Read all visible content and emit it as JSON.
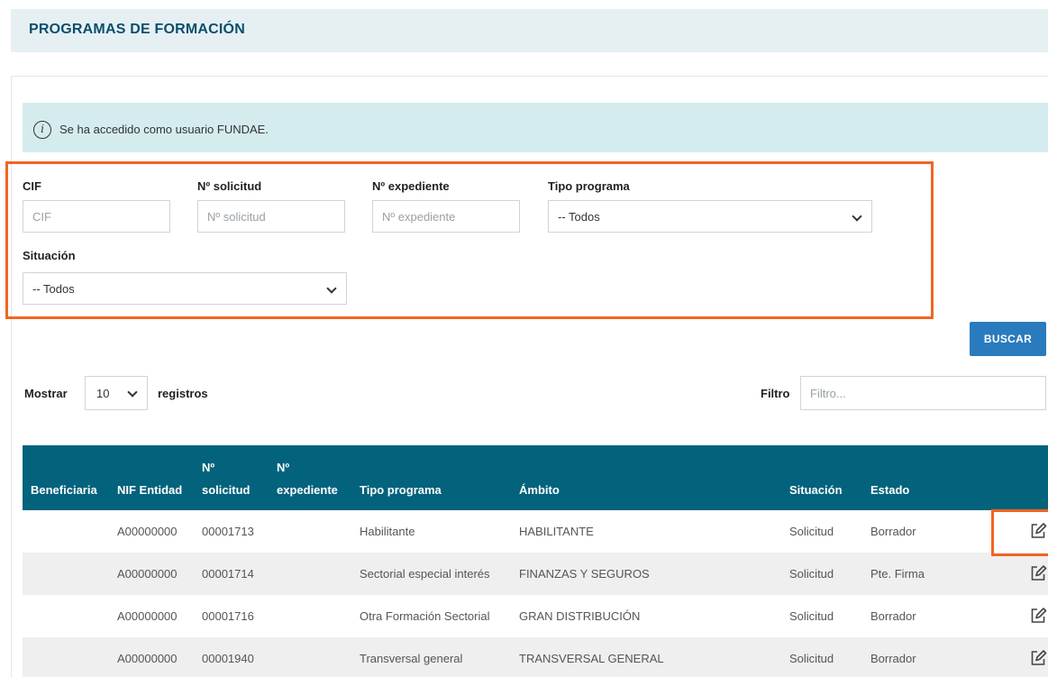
{
  "header": {
    "title": "PROGRAMAS DE FORMACIÓN"
  },
  "info": {
    "message": "Se ha accedido como usuario FUNDAE.",
    "icon": "info-icon"
  },
  "filters": {
    "cif": {
      "label": "CIF",
      "placeholder": "CIF"
    },
    "n_solicitud": {
      "label": "Nº solicitud",
      "placeholder": "Nº solicitud"
    },
    "n_expediente": {
      "label": "Nº expediente",
      "placeholder": "Nº expediente"
    },
    "tipo_programa": {
      "label": "Tipo programa",
      "value": "-- Todos"
    },
    "situacion": {
      "label": "Situación",
      "value": "-- Todos"
    }
  },
  "search_button": "BUSCAR",
  "list_controls": {
    "show_label": "Mostrar",
    "page_size": "10",
    "records_label": "registros",
    "filter_label": "Filtro",
    "filter_placeholder": "Filtro..."
  },
  "table": {
    "columns": {
      "beneficiaria": "Beneficiaria",
      "nif": "NIF Entidad",
      "solicitud_1": "Nº",
      "solicitud_2": "solicitud",
      "expediente_1": "Nº",
      "expediente_2": "expediente",
      "tipo": "Tipo programa",
      "ambito": "Ámbito",
      "situacion": "Situación",
      "estado": "Estado"
    },
    "rows": [
      {
        "beneficiaria": "",
        "nif": "A00000000",
        "solicitud": "00001713",
        "expediente": "",
        "tipo": "Habilitante",
        "ambito": "HABILITANTE",
        "situacion": "Solicitud",
        "estado": "Borrador"
      },
      {
        "beneficiaria": "",
        "nif": "A00000000",
        "solicitud": "00001714",
        "expediente": "",
        "tipo": "Sectorial especial interés",
        "ambito": "FINANZAS Y SEGUROS",
        "situacion": "Solicitud",
        "estado": "Pte. Firma"
      },
      {
        "beneficiaria": "",
        "nif": "A00000000",
        "solicitud": "00001716",
        "expediente": "",
        "tipo": "Otra Formación Sectorial",
        "ambito": "GRAN DISTRIBUCIÓN",
        "situacion": "Solicitud",
        "estado": "Borrador"
      },
      {
        "beneficiaria": "",
        "nif": "A00000000",
        "solicitud": "00001940",
        "expediente": "",
        "tipo": "Transversal general",
        "ambito": "TRANSVERSAL GENERAL",
        "situacion": "Solicitud",
        "estado": "Borrador"
      }
    ]
  },
  "colors": {
    "header_bg": "#e6f0f3",
    "title": "#0b4f6c",
    "info_bg": "#d5ecef",
    "table_head": "#03627c",
    "button": "#2a7bbd",
    "highlight": "#f26522"
  }
}
